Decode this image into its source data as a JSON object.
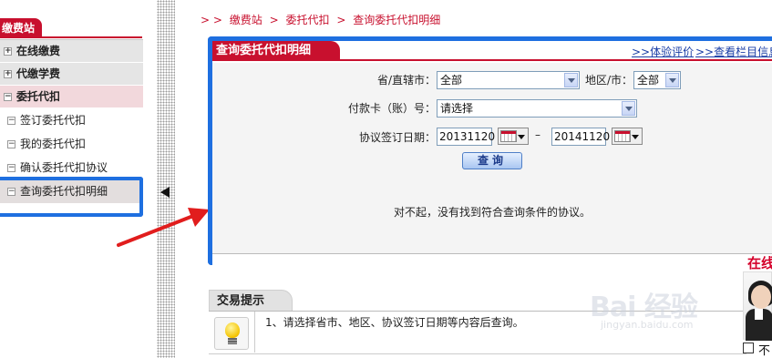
{
  "sidebar": {
    "title": "缴费站",
    "items": [
      {
        "label": "在线缴费",
        "sign": "+"
      },
      {
        "label": "代缴学费",
        "sign": "+"
      },
      {
        "label": "委托代扣",
        "sign": "−"
      }
    ],
    "subitems": [
      {
        "label": "签订委托代扣",
        "sign": "−"
      },
      {
        "label": "我的委托代扣",
        "sign": "−"
      },
      {
        "label": "确认委托代扣协议",
        "sign": "−"
      },
      {
        "label": "查询委托代扣明细",
        "sign": "−"
      }
    ]
  },
  "breadcrumb": {
    "prefix": "> >",
    "items": [
      "缴费站",
      "委托代扣",
      "查询委托代扣明细"
    ],
    "separator": ">"
  },
  "panel": {
    "title": "查询委托代扣明细",
    "links": [
      ">>体验评价",
      ">>查看栏目信息"
    ]
  },
  "form": {
    "province_label": "省/直辖市：",
    "province_value": "全部",
    "region_label": "地区/市：",
    "region_value": "全部",
    "card_label": "付款卡（账）号：",
    "card_value": "请选择",
    "date_label": "协议签订日期：",
    "date_from": "20131120",
    "date_to": "20141120",
    "date_sep": "–",
    "query_button": "查询"
  },
  "result_message": "对不起，没有找到符合查询条件的协议。",
  "tips": {
    "title": "交易提示",
    "text": "1、请选择省市、地区、协议签订日期等内容后查询。"
  },
  "widget": {
    "red_text": "在线",
    "checkbox_label": "不"
  },
  "watermark": {
    "main": "Bai 经验",
    "sub": "jingyan.baidu.com"
  },
  "colors": {
    "brand_red": "#c8102e",
    "highlight_blue": "#1e6fe0",
    "link_blue": "#1a3ea6"
  }
}
